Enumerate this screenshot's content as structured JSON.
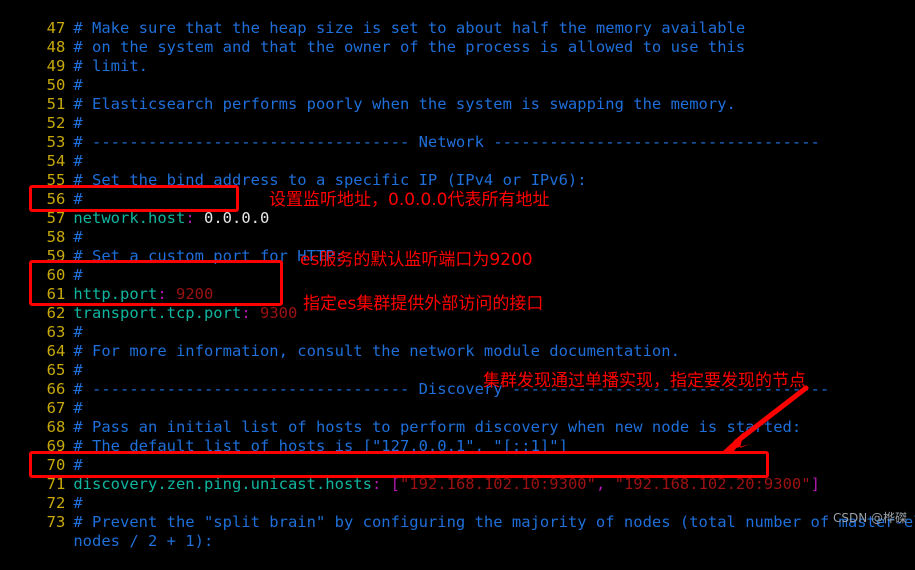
{
  "editor": {
    "background_color": "#000000",
    "line_number_color": "#c7a90a",
    "comment_color": "#1e6fd9",
    "key_color": "#0fb5a0",
    "punct_color": "#b417b4",
    "number_color": "#9c1212",
    "value_color": "#e8e8e8",
    "highlight_color": "#ff0000",
    "lines": [
      {
        "n": "47",
        "text": "# Make sure that the heap size is set to about half the memory available"
      },
      {
        "n": "48",
        "text": "# on the system and that the owner of the process is allowed to use this"
      },
      {
        "n": "49",
        "text": "# limit."
      },
      {
        "n": "50",
        "text": "#"
      },
      {
        "n": "51",
        "text": "# Elasticsearch performs poorly when the system is swapping the memory."
      },
      {
        "n": "52",
        "text": "#"
      },
      {
        "n": "53",
        "text": "# ---------------------------------- Network -----------------------------------"
      },
      {
        "n": "54",
        "text": "#"
      },
      {
        "n": "55",
        "text": "# Set the bind address to a specific IP (IPv4 or IPv6):"
      },
      {
        "n": "56",
        "text": "#"
      },
      {
        "n": "57",
        "text": "network.host: 0.0.0.0"
      },
      {
        "n": "58",
        "text": "#"
      },
      {
        "n": "59",
        "text": "# Set a custom port for HTTP:"
      },
      {
        "n": "60",
        "text": "#"
      },
      {
        "n": "61",
        "text": "http.port: 9200"
      },
      {
        "n": "62",
        "text": "transport.tcp.port: 9300"
      },
      {
        "n": "63",
        "text": "#"
      },
      {
        "n": "64",
        "text": "# For more information, consult the network module documentation."
      },
      {
        "n": "65",
        "text": "#"
      },
      {
        "n": "66",
        "text": "# ---------------------------------- Discovery ----------------------------------"
      },
      {
        "n": "67",
        "text": "#"
      },
      {
        "n": "68",
        "text": "# Pass an initial list of hosts to perform discovery when new node is started:"
      },
      {
        "n": "69",
        "text": "# The default list of hosts is [\"127.0.0.1\", \"[::1]\"]"
      },
      {
        "n": "70",
        "text": "#"
      },
      {
        "n": "71",
        "text": "discovery.zen.ping.unicast.hosts: [\"192.168.102.10:9300\", \"192.168.102.20:9300\"]"
      },
      {
        "n": "72",
        "text": "#"
      },
      {
        "n": "73",
        "text": "# Prevent the \"split brain\" by configuring the majority of nodes (total number of master-eligible"
      },
      {
        "n": "",
        "text": "nodes / 2 + 1):"
      }
    ],
    "tokens": {
      "l47": {
        "comment": "# Make sure that the heap size is set to about half the memory available"
      },
      "l48": {
        "comment": "# on the system and that the owner of the process is allowed to use this"
      },
      "l49": {
        "comment": "# limit."
      },
      "l50": {
        "comment": "#"
      },
      "l51": {
        "comment": "# Elasticsearch performs poorly when the system is swapping the memory."
      },
      "l52": {
        "comment": "#"
      },
      "l53": {
        "comment": "# ---------------------------------- Network -----------------------------------"
      },
      "l54": {
        "comment": "#"
      },
      "l55": {
        "comment": "# Set the bind address to a specific IP (IPv4 or IPv6):"
      },
      "l56": {
        "comment": "#"
      },
      "l57": {
        "key": "network.host",
        "colon": ":",
        "value": "0.0.0.0"
      },
      "l58": {
        "comment": "#"
      },
      "l59": {
        "comment": "# Set a custom port for HTTP:"
      },
      "l60": {
        "comment": "#"
      },
      "l61": {
        "key": "http.port",
        "colon": ":",
        "value": "9200"
      },
      "l62": {
        "key": "transport.tcp.port",
        "colon": ":",
        "value": "9300"
      },
      "l63": {
        "comment": "#"
      },
      "l64": {
        "comment": "# For more information, consult the network module documentation."
      },
      "l65": {
        "comment": "#"
      },
      "l66": {
        "comment": "# ---------------------------------- Discovery ----------------------------------"
      },
      "l67": {
        "comment": "#"
      },
      "l68": {
        "comment": "# Pass an initial list of hosts to perform discovery when new node is started:"
      },
      "l69": {
        "comment": "# The default list of hosts is [\"127.0.0.1\", \"[::1]\"]"
      },
      "l70": {
        "comment": "#"
      },
      "l71": {
        "key": "discovery.zen.ping.unicast.hosts",
        "colon": ":",
        "open_bracket": " [",
        "host1": "\"192.168.102.10:9300\"",
        "separator": ", ",
        "host2": "\"192.168.102.20:9300\"",
        "close_bracket": "]"
      },
      "l72": {
        "comment": "#"
      },
      "l73": {
        "comment": "# Prevent the \"split brain\" by configuring the majority of nodes (total number of master-eligible"
      },
      "l73b": {
        "comment": "nodes / 2 + 1):"
      }
    }
  },
  "annotations": [
    {
      "text": "设置监听地址，0.0.0.0代表所有地址",
      "target_line": "57"
    },
    {
      "text": "es服务的默认监听端口为9200",
      "target_line": "61"
    },
    {
      "text": "指定es集群提供外部访问的接口",
      "target_line": "62"
    },
    {
      "text": "集群发现通过单播实现，指定要发现的节点",
      "target_line": "71"
    }
  ],
  "watermark": {
    "text": "CSDN @桦磔"
  }
}
